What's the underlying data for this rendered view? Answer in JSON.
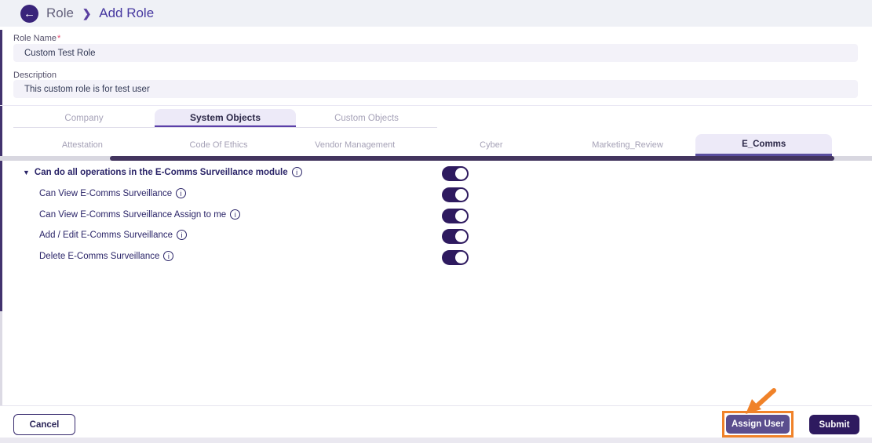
{
  "header": {
    "breadcrumb_root": "Role",
    "breadcrumb_separator": "❯",
    "breadcrumb_current": "Add Role",
    "back_icon_glyph": "←"
  },
  "form": {
    "role_name_label": "Role Name",
    "required_marker": "*",
    "role_name_value": "Custom Test Role",
    "description_label": "Description",
    "description_value": "This custom role is for test user"
  },
  "tabs": {
    "main": [
      {
        "label": "Company",
        "active": false
      },
      {
        "label": "System Objects",
        "active": true
      },
      {
        "label": "Custom Objects",
        "active": false
      }
    ],
    "sub": [
      {
        "label": "Attestation",
        "active": false
      },
      {
        "label": "Code Of Ethics",
        "active": false
      },
      {
        "label": "Vendor Management",
        "active": false
      },
      {
        "label": "Cyber",
        "active": false
      },
      {
        "label": "Marketing_Review",
        "active": false
      },
      {
        "label": "E_Comms",
        "active": true
      }
    ]
  },
  "permissions": {
    "caret_glyph": "▼",
    "info_glyph": "i",
    "rows": [
      {
        "label": "Can do all operations in the E-Comms Surveillance module",
        "level": "root",
        "expanded": true,
        "enabled": true
      },
      {
        "label": "Can View E-Comms Surveillance",
        "level": "child",
        "enabled": true
      },
      {
        "label": "Can View E-Comms Surveillance Assign to me",
        "level": "child",
        "enabled": true
      },
      {
        "label": "Add / Edit E-Comms Surveillance",
        "level": "child",
        "enabled": true
      },
      {
        "label": "Delete E-Comms Surveillance",
        "level": "child",
        "enabled": true
      }
    ]
  },
  "footer": {
    "cancel_label": "Cancel",
    "assign_user_label": "Assign User",
    "submit_label": "Submit"
  },
  "colors": {
    "accent_purple": "#5b3fa8",
    "dark_purple": "#2e1a5f",
    "assign_button_purple": "#5b4e8e",
    "annotation_orange": "#f08229",
    "header_bg": "#eff1f6",
    "input_bg": "#f3f2f9",
    "required_red": "#e8486e"
  }
}
